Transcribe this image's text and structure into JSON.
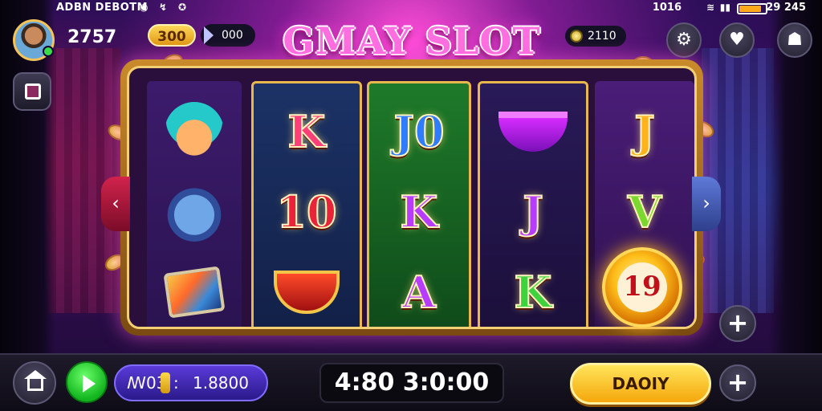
{
  "status_bar": {
    "carrier": "ADBN DEBOTM",
    "time": "29 245",
    "network": "1016",
    "battery_level": 0.85
  },
  "player": {
    "score": "2757",
    "coins": "300",
    "gems": "000",
    "balance": "2110"
  },
  "game": {
    "title": "GMAY SLOT"
  },
  "reels": [
    [
      "jester",
      "cat",
      "card"
    ],
    [
      "K",
      "10",
      "cup"
    ],
    [
      "J0",
      "K",
      "A"
    ],
    [
      "bowl",
      "J",
      "K"
    ],
    [
      "J",
      "V",
      "19"
    ]
  ],
  "bonus_value": "19",
  "bottom": {
    "bet_label": "ꟿ03",
    "bet_sep": ":",
    "bet_value": "1.8800",
    "timer": "4:80 3:0:00",
    "spin_label": "DAOIY"
  },
  "icons": {
    "settings": "gear-icon",
    "support": "headset-icon",
    "profile": "user-icon",
    "book": "book-icon",
    "home": "home-icon",
    "play": "play-icon",
    "add": "plus-icon"
  },
  "colors": {
    "accent": "#ff4fd8",
    "gold": "#ffb21c",
    "spin": "#f5a70c"
  }
}
